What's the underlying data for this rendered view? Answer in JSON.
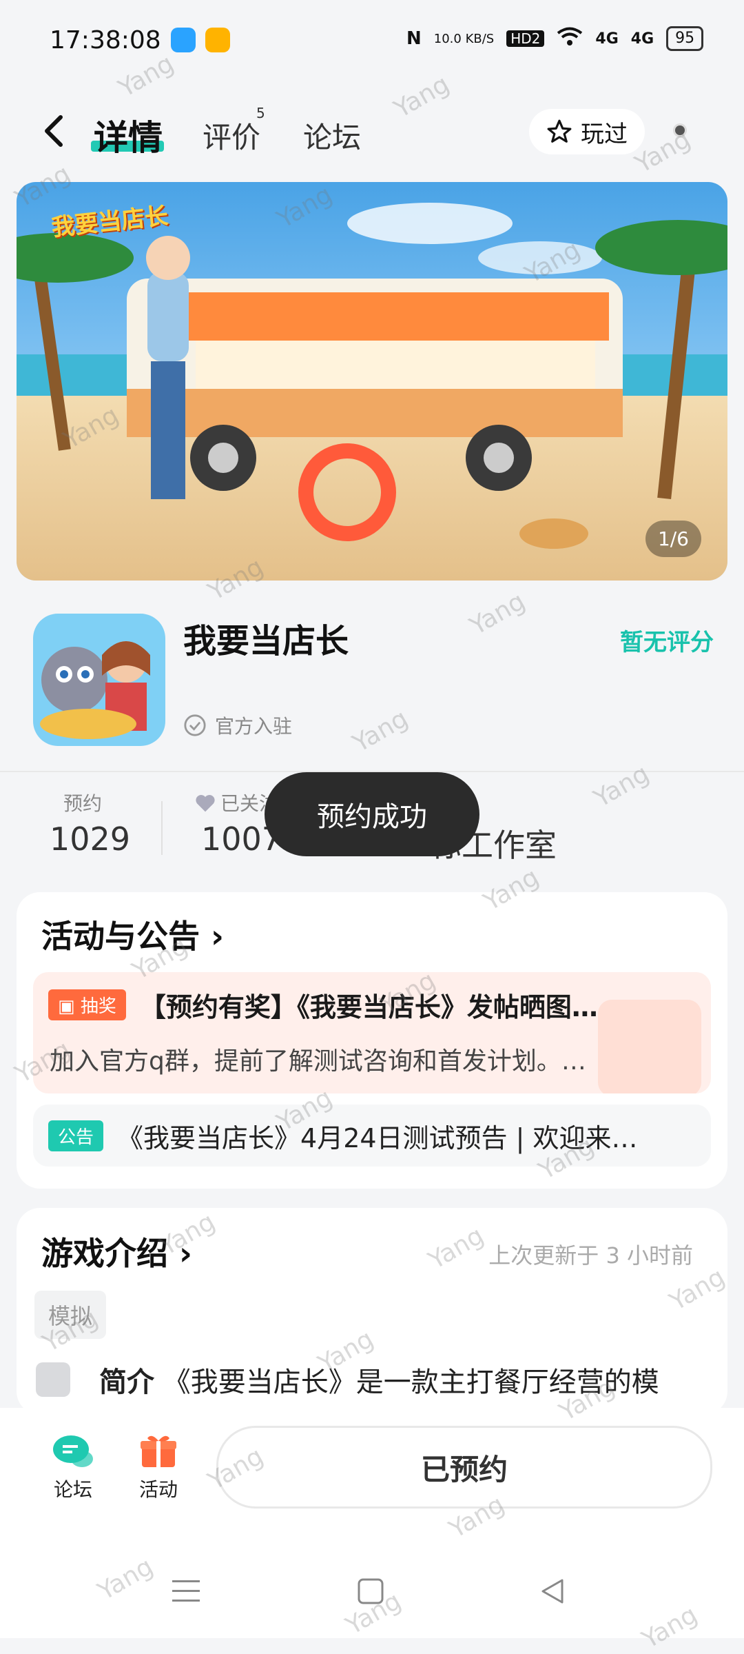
{
  "status_bar": {
    "time": "17:38:08",
    "net_speed": "10.0 KB/S",
    "hd": "HD2",
    "sig1": "4G",
    "sig2": "4G",
    "battery": "95"
  },
  "header": {
    "tabs": [
      {
        "label": "详情"
      },
      {
        "label": "评价"
      },
      {
        "label": "论坛"
      }
    ],
    "review_badge": "5",
    "played_label": "玩过"
  },
  "banner": {
    "counter": "1/6",
    "logo_text": "我要当店长"
  },
  "app": {
    "name": "我要当店长",
    "rating": "暂无评分",
    "official": "官方入驻"
  },
  "stats": {
    "reserve_label": "预约",
    "reserve_value": "1029",
    "follow_label": "已关注",
    "follow_value": "1007",
    "dev_value": "标工作室"
  },
  "toast": "预约成功",
  "activities": {
    "title": "活动与公告",
    "promo": {
      "tag": "抽奖",
      "title": "【预约有奖】《我要当店长》发帖晒图…",
      "desc": "加入官方q群，提前了解测试咨询和首发计划。…"
    },
    "notice": {
      "tag": "公告",
      "text": "《我要当店长》4月24日测试预告 | 欢迎来…"
    }
  },
  "intro": {
    "title": "游戏介绍",
    "updated": "上次更新于 3 小时前",
    "chip": "模拟",
    "label": "简介",
    "text": "《我要当店长》是一款主打餐厅经营的模"
  },
  "bottom": {
    "forum": "论坛",
    "activity": "活动",
    "reserved": "已预约"
  },
  "watermark": "Yang",
  "colors": {
    "accent": "#22c9b4",
    "rating": "#19c2ac",
    "promo_tag": "#ff6a3d",
    "notice_tag": "#1fc9b0",
    "toast_bg": "#2b2b2b"
  }
}
